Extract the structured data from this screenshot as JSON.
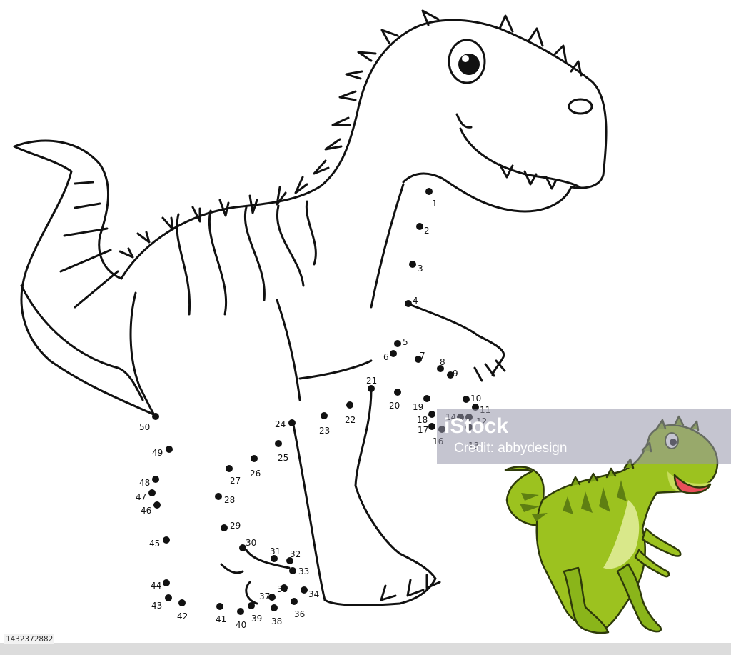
{
  "watermark": {
    "brand": "iStock",
    "credit": "Credit: abbydesign"
  },
  "image_id": "1432372882",
  "colors": {
    "outline": "#111111",
    "dino_green": "#9cc21f",
    "dino_dark": "#5e7f12",
    "belly": "#d9e88a",
    "mouth": "#e94f5a"
  },
  "dots": [
    {
      "n": "1"
    },
    {
      "n": "2"
    },
    {
      "n": "3"
    },
    {
      "n": "4"
    },
    {
      "n": "5"
    },
    {
      "n": "6"
    },
    {
      "n": "7"
    },
    {
      "n": "8"
    },
    {
      "n": "9"
    },
    {
      "n": "10"
    },
    {
      "n": "11"
    },
    {
      "n": "12"
    },
    {
      "n": "13"
    },
    {
      "n": "14"
    },
    {
      "n": "16"
    },
    {
      "n": "17"
    },
    {
      "n": "18"
    },
    {
      "n": "19"
    },
    {
      "n": "20"
    },
    {
      "n": "21"
    },
    {
      "n": "22"
    },
    {
      "n": "23"
    },
    {
      "n": "24"
    },
    {
      "n": "25"
    },
    {
      "n": "26"
    },
    {
      "n": "27"
    },
    {
      "n": "28"
    },
    {
      "n": "29"
    },
    {
      "n": "30"
    },
    {
      "n": "31"
    },
    {
      "n": "32"
    },
    {
      "n": "33"
    },
    {
      "n": "34"
    },
    {
      "n": "35"
    },
    {
      "n": "36"
    },
    {
      "n": "37"
    },
    {
      "n": "38"
    },
    {
      "n": "39"
    },
    {
      "n": "40"
    },
    {
      "n": "41"
    },
    {
      "n": "42"
    },
    {
      "n": "43"
    },
    {
      "n": "44"
    },
    {
      "n": "45"
    },
    {
      "n": "46"
    },
    {
      "n": "47"
    },
    {
      "n": "48"
    },
    {
      "n": "49"
    },
    {
      "n": "50"
    }
  ]
}
